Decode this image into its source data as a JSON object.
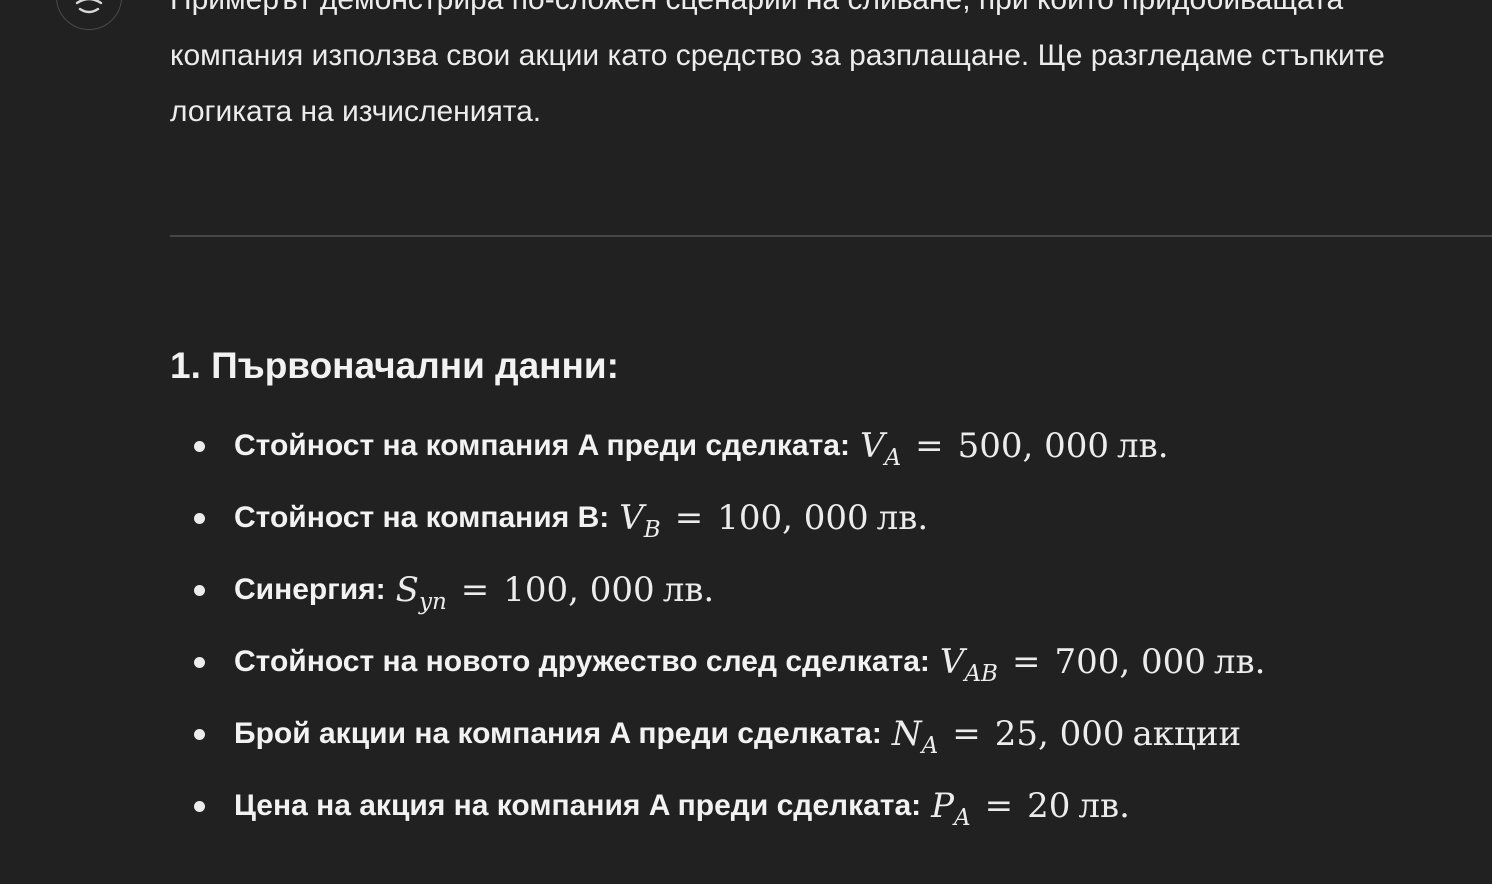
{
  "message": {
    "intro_lines": [
      "Примерът демонстрира по-сложен сценарий на сливане, при който придобиващата",
      "компания използва свои акции като средство за разплащане. Ще разгледаме стъпките",
      "логиката на изчисленията."
    ],
    "section_heading": "1. Първоначални данни:",
    "items": [
      {
        "label": "Стойност на компания A преди сделката:",
        "var": "V",
        "sub": "A",
        "eq": "=",
        "value": "500, 000",
        "unit": "лв."
      },
      {
        "label": "Стойност на компания B:",
        "var": "V",
        "sub": "B",
        "eq": "=",
        "value": "100, 000",
        "unit": "лв."
      },
      {
        "label": "Синергия:",
        "var": "S",
        "sub": "yn",
        "eq": "=",
        "value": "100, 000",
        "unit": "лв."
      },
      {
        "label": "Стойност на новото дружество след сделката:",
        "var": "V",
        "sub": "AB",
        "eq": "=",
        "value": "700, 000",
        "unit": "лв."
      },
      {
        "label": "Брой акции на компания A преди сделката:",
        "var": "N",
        "sub": "A",
        "eq": "=",
        "value": "25, 000",
        "unit": "акции"
      },
      {
        "label": "Цена на акция на компания A преди сделката:",
        "var": "P",
        "sub": "A",
        "eq": "=",
        "value": "20",
        "unit": "лв."
      }
    ]
  },
  "icons": {
    "avatar": "assistant-logo-icon"
  },
  "colors": {
    "background": "#212121",
    "text": "#ececec",
    "divider": "#464646"
  }
}
